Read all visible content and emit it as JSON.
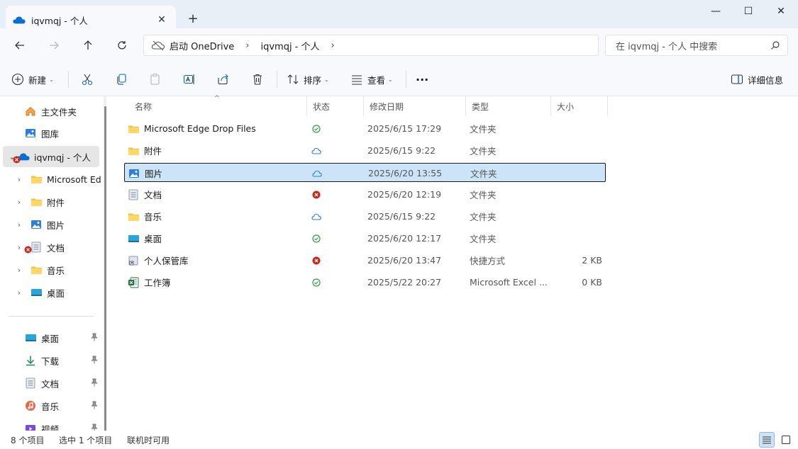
{
  "window": {
    "tab_title": "iqvmqj - 个人",
    "tab_close": "✕",
    "new_tab": "+",
    "minimize": "—",
    "maximize": "☐",
    "close": "✕"
  },
  "nav": {
    "back": "←",
    "forward": "→",
    "up": "↑",
    "refresh": "↻",
    "breadcrumb": [
      "启动 OneDrive",
      "iqvmqj - 个人"
    ],
    "breadcrumb_sep": "›",
    "search_placeholder": "在 iqvmqj - 个人 中搜索"
  },
  "toolbar": {
    "new_label": "新建",
    "sort_label": "排序",
    "view_label": "查看",
    "more_label": "···",
    "details_label": "详细信息",
    "caret": "⌄"
  },
  "sidebar": {
    "quick": [
      {
        "label": "主文件夹",
        "icon": "home-icon"
      },
      {
        "label": "图库",
        "icon": "gallery-icon"
      }
    ],
    "onedrive": {
      "label": "iqvmqj - 个人",
      "expander": "⌄"
    },
    "children": [
      {
        "label": "Microsoft Ed",
        "icon": "folder-icon",
        "expander": "›"
      },
      {
        "label": "附件",
        "icon": "folder-icon",
        "expander": "›"
      },
      {
        "label": "图片",
        "icon": "pictures-icon",
        "expander": "›"
      },
      {
        "label": "文档",
        "icon": "document-icon",
        "expander": "›"
      },
      {
        "label": "音乐",
        "icon": "folder-icon",
        "expander": "›"
      },
      {
        "label": "桌面",
        "icon": "desktop-icon",
        "expander": "›"
      }
    ],
    "pinned": [
      {
        "label": "桌面",
        "icon": "desktop-icon"
      },
      {
        "label": "下载",
        "icon": "download-icon"
      },
      {
        "label": "文档",
        "icon": "document-icon"
      },
      {
        "label": "音乐",
        "icon": "music-icon"
      },
      {
        "label": "视频",
        "icon": "video-icon"
      }
    ],
    "pin_glyph": "📌"
  },
  "columns": {
    "name": "名称",
    "status": "状态",
    "modified": "修改日期",
    "type": "类型",
    "size": "大小",
    "sort_arrow": "^"
  },
  "files": [
    {
      "name": "Microsoft Edge Drop Files",
      "icon": "folder-icon",
      "status": "synced",
      "date": "2025/6/15 17:29",
      "type": "文件夹",
      "size": ""
    },
    {
      "name": "附件",
      "icon": "folder-icon",
      "status": "cloud",
      "date": "2025/6/15 9:22",
      "type": "文件夹",
      "size": ""
    },
    {
      "name": "图片",
      "icon": "pictures-icon",
      "status": "cloud",
      "date": "2025/6/20 13:55",
      "type": "文件夹",
      "size": ""
    },
    {
      "name": "文档",
      "icon": "document-icon",
      "status": "error",
      "date": "2025/6/20 12:19",
      "type": "文件夹",
      "size": ""
    },
    {
      "name": "音乐",
      "icon": "folder-icon",
      "status": "cloud",
      "date": "2025/6/15 9:22",
      "type": "文件夹",
      "size": ""
    },
    {
      "name": "桌面",
      "icon": "desktop-icon",
      "status": "synced",
      "date": "2025/6/20 12:17",
      "type": "文件夹",
      "size": ""
    },
    {
      "name": "个人保管库",
      "icon": "shortcut-icon",
      "status": "error",
      "date": "2025/6/20 13:47",
      "type": "快捷方式",
      "size": "2 KB"
    },
    {
      "name": "工作簿",
      "icon": "excel-icon",
      "status": "synced",
      "date": "2025/5/22 20:27",
      "type": "Microsoft Excel ...",
      "size": "0 KB"
    }
  ],
  "statusbar": {
    "count": "8 个项目",
    "selected": "选中 1 个项目",
    "availability": "联机时可用"
  },
  "colors": {
    "accent": "#0067c0",
    "selection": "#cce4f7",
    "synced": "#2e9e48",
    "error": "#c42b1c",
    "folder": "#f6c342"
  }
}
